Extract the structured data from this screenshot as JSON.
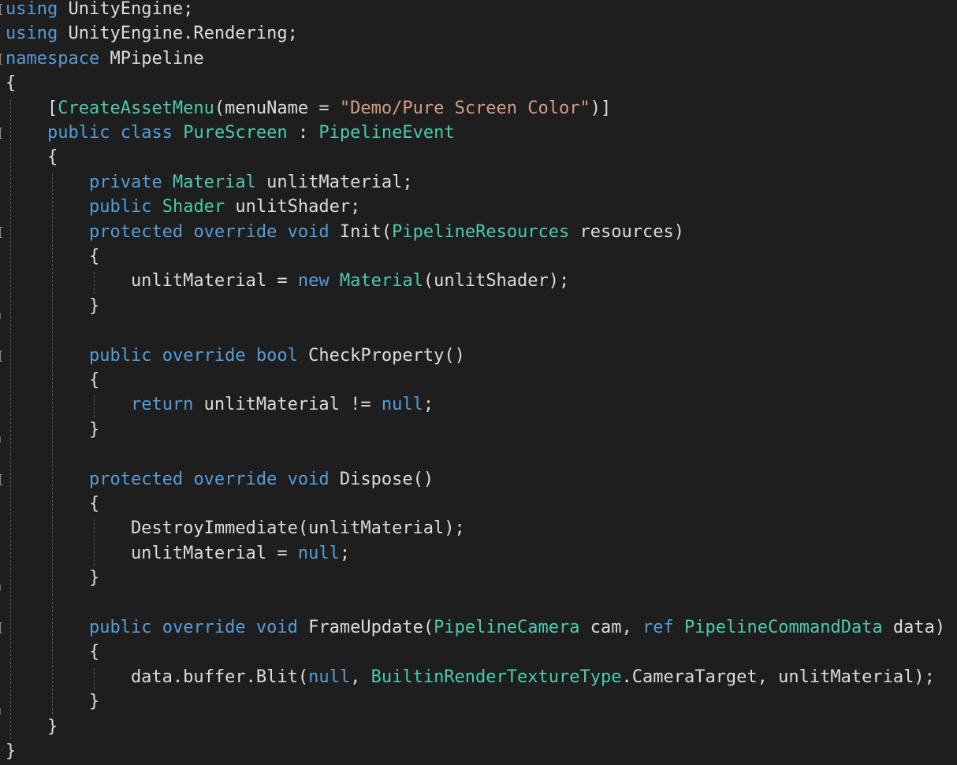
{
  "editor": {
    "theme": {
      "background": "#1e1e1e",
      "keyword": "#569cd6",
      "type": "#4ec9b0",
      "string": "#d69d85",
      "plain": "#dcdcdc",
      "guide": "#5a5a5a"
    },
    "lines": [
      [
        {
          "t": "using",
          "c": "keyword"
        },
        {
          "t": " UnityEngine;",
          "c": "plain"
        }
      ],
      [
        {
          "t": "using",
          "c": "keyword"
        },
        {
          "t": " UnityEngine.Rendering;",
          "c": "plain"
        }
      ],
      [
        {
          "t": "namespace",
          "c": "keyword"
        },
        {
          "t": " MPipeline",
          "c": "plain"
        }
      ],
      [
        {
          "t": "{",
          "c": "plain"
        }
      ],
      [
        {
          "t": "    [",
          "c": "plain"
        },
        {
          "t": "CreateAssetMenu",
          "c": "type"
        },
        {
          "t": "(menuName = ",
          "c": "plain"
        },
        {
          "t": "\"Demo/Pure Screen Color\"",
          "c": "string"
        },
        {
          "t": ")]",
          "c": "plain"
        }
      ],
      [
        {
          "t": "    ",
          "c": "plain"
        },
        {
          "t": "public",
          "c": "keyword"
        },
        {
          "t": " ",
          "c": "plain"
        },
        {
          "t": "class",
          "c": "keyword"
        },
        {
          "t": " ",
          "c": "plain"
        },
        {
          "t": "PureScreen",
          "c": "type"
        },
        {
          "t": " : ",
          "c": "plain"
        },
        {
          "t": "PipelineEvent",
          "c": "type"
        }
      ],
      [
        {
          "t": "    {",
          "c": "plain"
        }
      ],
      [
        {
          "t": "        ",
          "c": "plain"
        },
        {
          "t": "private",
          "c": "keyword"
        },
        {
          "t": " ",
          "c": "plain"
        },
        {
          "t": "Material",
          "c": "type"
        },
        {
          "t": " unlitMaterial;",
          "c": "plain"
        }
      ],
      [
        {
          "t": "        ",
          "c": "plain"
        },
        {
          "t": "public",
          "c": "keyword"
        },
        {
          "t": " ",
          "c": "plain"
        },
        {
          "t": "Shader",
          "c": "type"
        },
        {
          "t": " unlitShader;",
          "c": "plain"
        }
      ],
      [
        {
          "t": "        ",
          "c": "plain"
        },
        {
          "t": "protected",
          "c": "keyword"
        },
        {
          "t": " ",
          "c": "plain"
        },
        {
          "t": "override",
          "c": "keyword"
        },
        {
          "t": " ",
          "c": "plain"
        },
        {
          "t": "void",
          "c": "keyword"
        },
        {
          "t": " Init(",
          "c": "plain"
        },
        {
          "t": "PipelineResources",
          "c": "type"
        },
        {
          "t": " resources)",
          "c": "plain"
        }
      ],
      [
        {
          "t": "        {",
          "c": "plain"
        }
      ],
      [
        {
          "t": "            unlitMaterial = ",
          "c": "plain"
        },
        {
          "t": "new",
          "c": "keyword"
        },
        {
          "t": " ",
          "c": "plain"
        },
        {
          "t": "Material",
          "c": "type"
        },
        {
          "t": "(unlitShader);",
          "c": "plain"
        }
      ],
      [
        {
          "t": "        }",
          "c": "plain"
        }
      ],
      [],
      [
        {
          "t": "        ",
          "c": "plain"
        },
        {
          "t": "public",
          "c": "keyword"
        },
        {
          "t": " ",
          "c": "plain"
        },
        {
          "t": "override",
          "c": "keyword"
        },
        {
          "t": " ",
          "c": "plain"
        },
        {
          "t": "bool",
          "c": "keyword"
        },
        {
          "t": " CheckProperty()",
          "c": "plain"
        }
      ],
      [
        {
          "t": "        {",
          "c": "plain"
        }
      ],
      [
        {
          "t": "            ",
          "c": "plain"
        },
        {
          "t": "return",
          "c": "keyword"
        },
        {
          "t": " unlitMaterial != ",
          "c": "plain"
        },
        {
          "t": "null",
          "c": "keyword"
        },
        {
          "t": ";",
          "c": "plain"
        }
      ],
      [
        {
          "t": "        }",
          "c": "plain"
        }
      ],
      [],
      [
        {
          "t": "        ",
          "c": "plain"
        },
        {
          "t": "protected",
          "c": "keyword"
        },
        {
          "t": " ",
          "c": "plain"
        },
        {
          "t": "override",
          "c": "keyword"
        },
        {
          "t": " ",
          "c": "plain"
        },
        {
          "t": "void",
          "c": "keyword"
        },
        {
          "t": " Dispose()",
          "c": "plain"
        }
      ],
      [
        {
          "t": "        {",
          "c": "plain"
        }
      ],
      [
        {
          "t": "            DestroyImmediate(unlitMaterial);",
          "c": "plain"
        }
      ],
      [
        {
          "t": "            unlitMaterial = ",
          "c": "plain"
        },
        {
          "t": "null",
          "c": "keyword"
        },
        {
          "t": ";",
          "c": "plain"
        }
      ],
      [
        {
          "t": "        }",
          "c": "plain"
        }
      ],
      [],
      [
        {
          "t": "        ",
          "c": "plain"
        },
        {
          "t": "public",
          "c": "keyword"
        },
        {
          "t": " ",
          "c": "plain"
        },
        {
          "t": "override",
          "c": "keyword"
        },
        {
          "t": " ",
          "c": "plain"
        },
        {
          "t": "void",
          "c": "keyword"
        },
        {
          "t": " FrameUpdate(",
          "c": "plain"
        },
        {
          "t": "PipelineCamera",
          "c": "type"
        },
        {
          "t": " cam, ",
          "c": "plain"
        },
        {
          "t": "ref",
          "c": "keyword"
        },
        {
          "t": " ",
          "c": "plain"
        },
        {
          "t": "PipelineCommandData",
          "c": "type"
        },
        {
          "t": " data)",
          "c": "plain"
        }
      ],
      [
        {
          "t": "        {",
          "c": "plain"
        }
      ],
      [
        {
          "t": "            data.buffer.Blit(",
          "c": "plain"
        },
        {
          "t": "null",
          "c": "keyword"
        },
        {
          "t": ", ",
          "c": "plain"
        },
        {
          "t": "BuiltinRenderTextureType",
          "c": "type"
        },
        {
          "t": ".CameraTarget, unlitMaterial);",
          "c": "plain"
        }
      ],
      [
        {
          "t": "        }",
          "c": "plain"
        }
      ],
      [
        {
          "t": "    }",
          "c": "plain"
        }
      ],
      [
        {
          "t": "}",
          "c": "plain"
        }
      ]
    ]
  }
}
